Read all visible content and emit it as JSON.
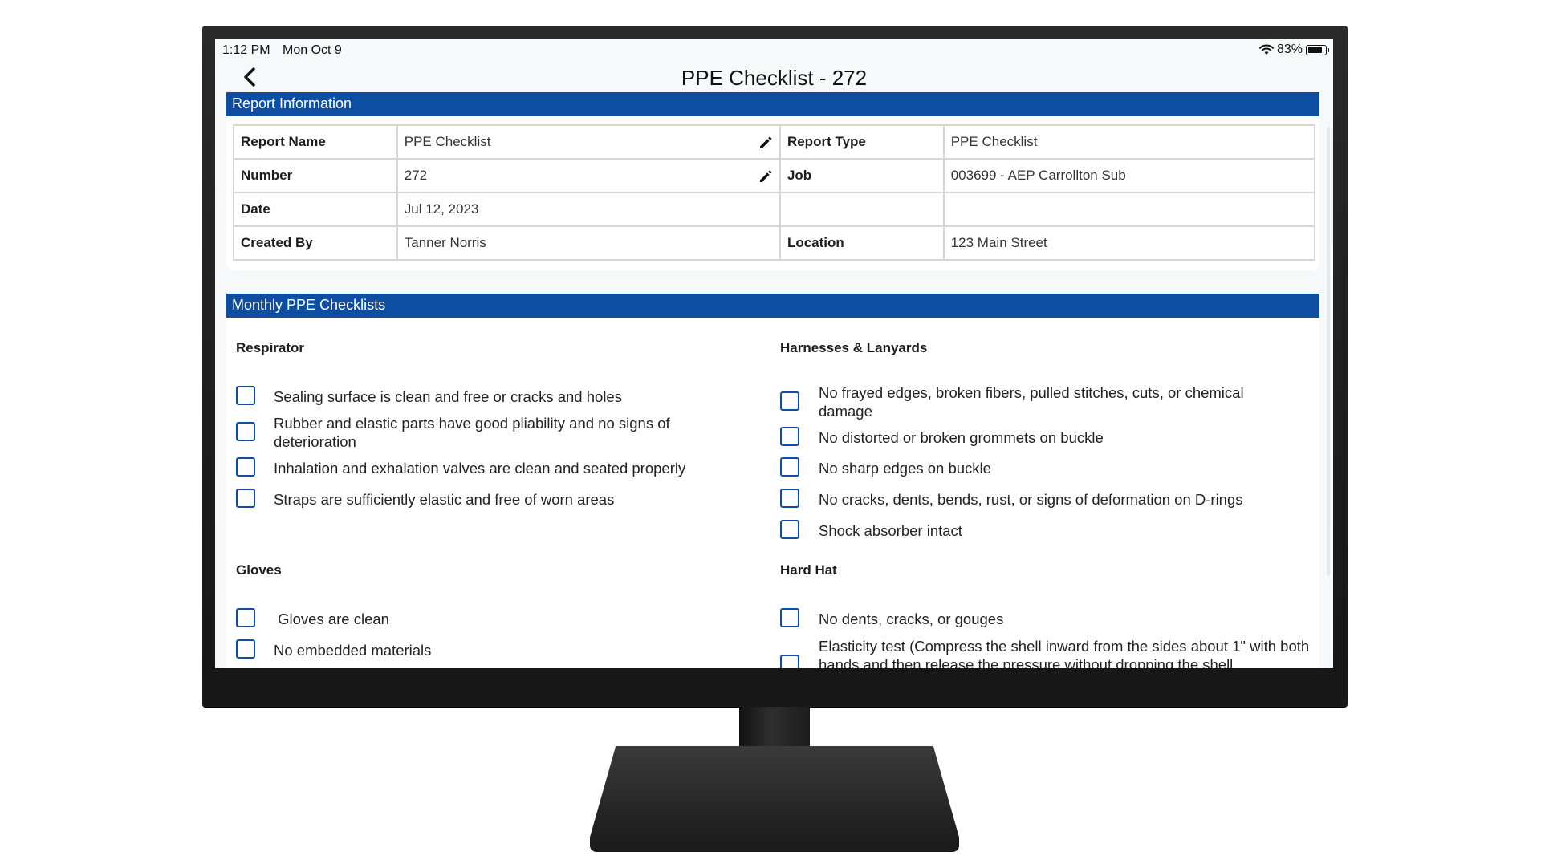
{
  "status_bar": {
    "time": "1:12 PM",
    "date": "Mon Oct 9",
    "battery": "83%",
    "battery_level": 0.83
  },
  "nav": {
    "title": "PPE Checklist - 272"
  },
  "report_info": {
    "header": "Report Information",
    "rows": [
      {
        "label1": "Report Name",
        "value1": "PPE Checklist",
        "label2": "Report Type",
        "value2": "PPE Checklist"
      },
      {
        "label1": "Number",
        "value1": "272",
        "label2": "Job",
        "value2": "003699 - AEP Carrollton Sub"
      },
      {
        "label1": "Date",
        "value1": "Jul 12, 2023",
        "label2": "",
        "value2": ""
      },
      {
        "label1": "Created By",
        "value1": "Tanner Norris",
        "label2": "Location",
        "value2": "123 Main Street"
      }
    ]
  },
  "checklists": {
    "header": "Monthly PPE Checklists",
    "respirator": {
      "title": "Respirator",
      "items": [
        "Sealing surface is clean and free or cracks and holes",
        "Rubber and elastic parts have good pliability and no signs of deterioration",
        "Inhalation and exhalation valves are clean and seated properly",
        "Straps are sufficiently elastic and free of worn areas"
      ]
    },
    "harnesses": {
      "title": "Harnesses & Lanyards",
      "items": [
        "No frayed edges, broken fibers, pulled stitches, cuts, or chemical damage",
        "No distorted or broken grommets on buckle",
        "No sharp edges on buckle",
        "No cracks, dents, bends, rust, or signs of deformation on D-rings",
        "Shock absorber intact"
      ]
    },
    "gloves": {
      "title": "Gloves",
      "items": [
        " Gloves are clean",
        "No embedded materials"
      ]
    },
    "hard_hat": {
      "title": "Hard Hat",
      "items": [
        "No dents, cracks, or gouges",
        "Elasticity test (Compress the shell inward from the sides about 1\" with both hands and then release the pressure without dropping the shell."
      ]
    }
  },
  "colors": {
    "accent": "#0d4ea3",
    "header_text": "#ffffff"
  }
}
